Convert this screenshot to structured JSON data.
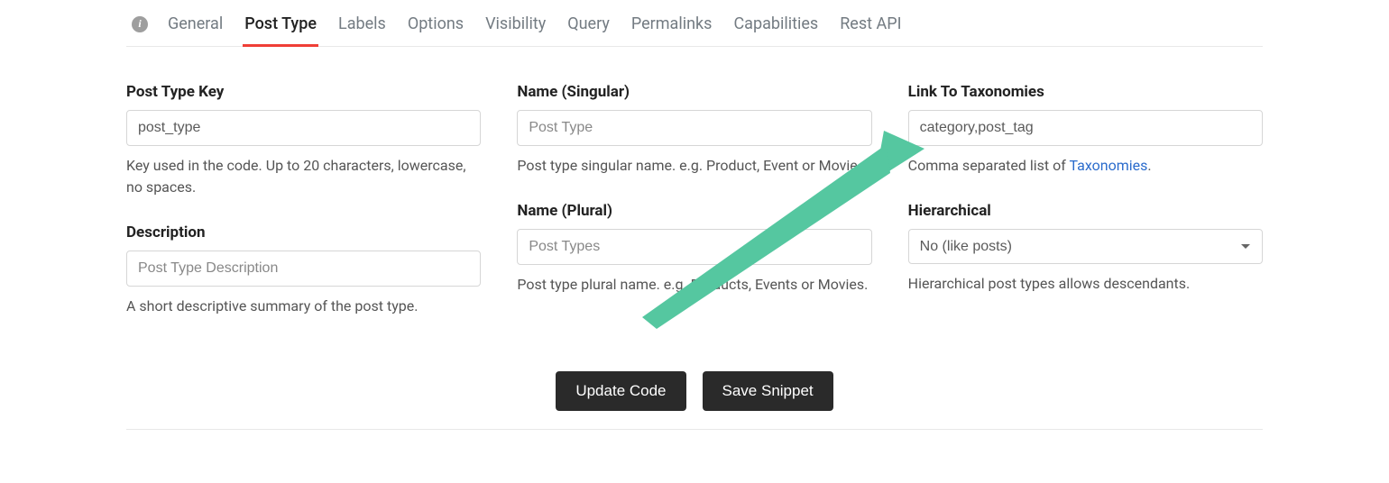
{
  "tabs": {
    "general": "General",
    "post_type": "Post Type",
    "labels": "Labels",
    "options": "Options",
    "visibility": "Visibility",
    "query": "Query",
    "permalinks": "Permalinks",
    "capabilities": "Capabilities",
    "rest_api": "Rest API"
  },
  "col1": {
    "post_type_key": {
      "label": "Post Type Key",
      "value": "post_type",
      "help": "Key used in the code. Up to 20 characters, lowercase, no spaces."
    },
    "description": {
      "label": "Description",
      "placeholder": "Post Type Description",
      "help": "A short descriptive summary of the post type."
    }
  },
  "col2": {
    "name_singular": {
      "label": "Name (Singular)",
      "placeholder": "Post Type",
      "help": "Post type singular name. e.g. Product, Event or Movie."
    },
    "name_plural": {
      "label": "Name (Plural)",
      "placeholder": "Post Types",
      "help": "Post type plural name. e.g. Products, Events or Movies."
    }
  },
  "col3": {
    "link_taxonomies": {
      "label": "Link To Taxonomies",
      "value": "category,post_tag",
      "help_prefix": "Comma separated list of ",
      "help_link": "Taxonomies",
      "help_suffix": "."
    },
    "hierarchical": {
      "label": "Hierarchical",
      "value": "No (like posts)",
      "help": "Hierarchical post types allows descendants."
    }
  },
  "buttons": {
    "update_code": "Update Code",
    "save_snippet": "Save Snippet"
  },
  "annotation": {
    "arrow_color": "#55c7a0"
  }
}
